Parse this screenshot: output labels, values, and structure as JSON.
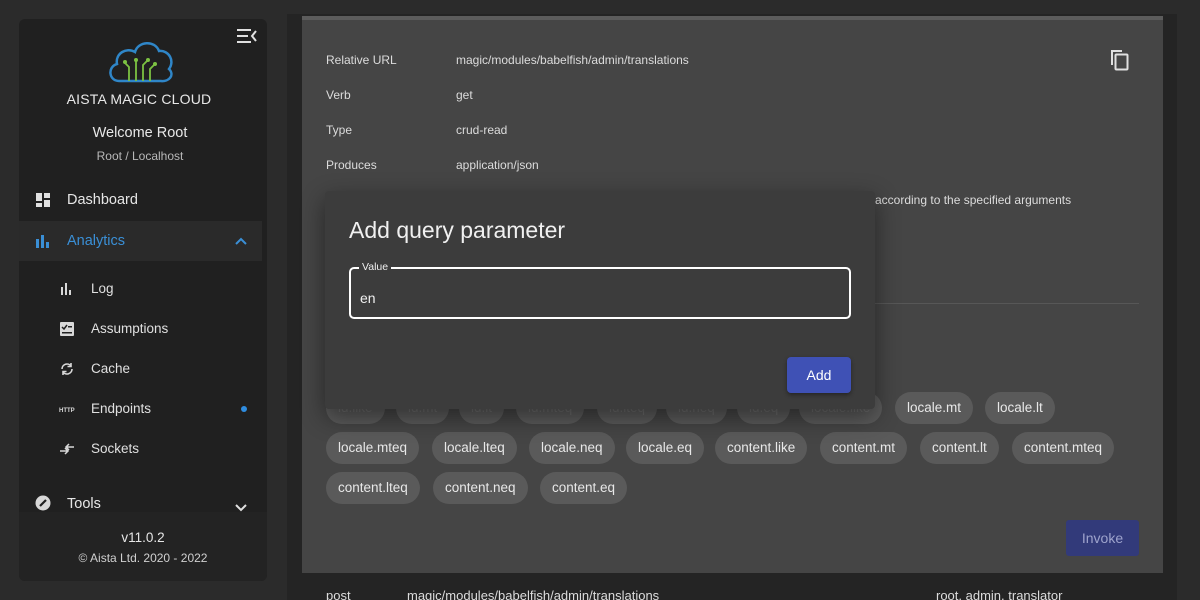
{
  "colors": {
    "accent": "#3a8fd6",
    "primary_button": "#3f51b5",
    "dot": "#2f8de0"
  },
  "sidebar": {
    "brand": "AISTA MAGIC CLOUD",
    "welcome": "Welcome Root",
    "user_sub": "Root / Localhost",
    "items": [
      {
        "label": "Dashboard",
        "icon": "dashboard-icon"
      },
      {
        "label": "Analytics",
        "icon": "bar-chart-icon",
        "active": true,
        "expanded": true
      },
      {
        "label": "Tools",
        "icon": "wrench-icon",
        "expanded": false
      }
    ],
    "sub_items": [
      {
        "label": "Log",
        "icon": "bar-chart-icon"
      },
      {
        "label": "Assumptions",
        "icon": "checklist-icon"
      },
      {
        "label": "Cache",
        "icon": "refresh-icon"
      },
      {
        "label": "Endpoints",
        "icon": "http-icon",
        "badge": true
      },
      {
        "label": "Sockets",
        "icon": "sockets-icon"
      }
    ],
    "version": "v11.0.2",
    "copyright": "© Aista Ltd. 2020 - 2022"
  },
  "endpoint": {
    "rows": [
      {
        "key": "Relative URL",
        "value": "magic/modules/babelfish/admin/translations"
      },
      {
        "key": "Verb",
        "value": "get"
      },
      {
        "key": "Type",
        "value": "crud-read"
      },
      {
        "key": "Produces",
        "value": "application/json"
      }
    ],
    "description_fragment": "according to the specified arguments",
    "invoke_label": "Invoke"
  },
  "chips": {
    "hidden_row": [
      "id.like",
      "id.mt",
      "id.lt",
      "id.mteq",
      "id.lteq",
      "id.neq",
      "id.eq",
      "locale.like"
    ],
    "row1": [
      "locale.mt",
      "locale.lt"
    ],
    "row2": [
      "locale.mteq",
      "locale.lteq",
      "locale.neq",
      "locale.eq",
      "content.like",
      "content.mt",
      "content.lt",
      "content.mteq"
    ],
    "row3": [
      "content.lteq",
      "content.neq",
      "content.eq"
    ]
  },
  "next_endpoint": {
    "verb": "post",
    "url": "magic/modules/babelfish/admin/translations",
    "auth": "root, admin, translator"
  },
  "dialog": {
    "title": "Add query parameter",
    "field_label": "Value",
    "field_value": "en",
    "add_label": "Add"
  }
}
